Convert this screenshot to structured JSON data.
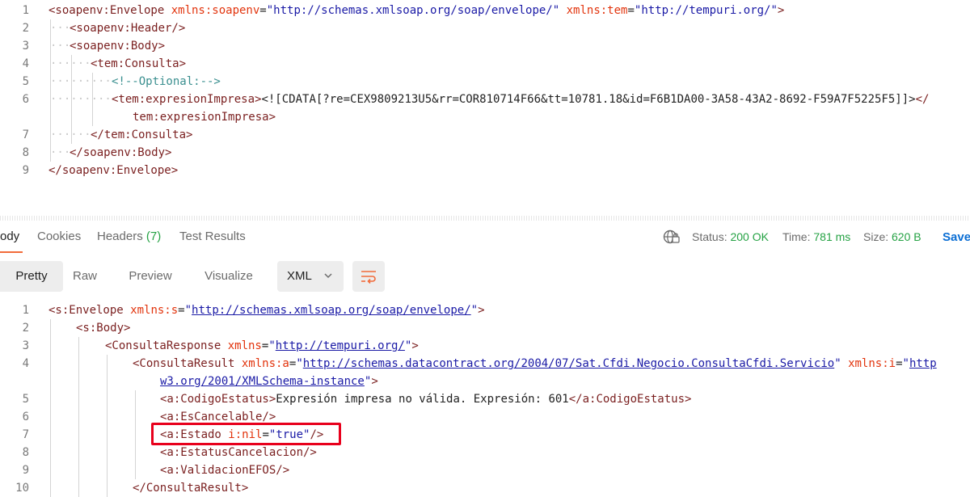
{
  "request": {
    "lines": [
      {
        "n": "1",
        "segs": [
          [
            "tag",
            "<soapenv:Envelope "
          ],
          [
            "attr",
            "xmlns:soapenv"
          ],
          [
            "dark",
            "="
          ],
          [
            "str",
            "\"http://schemas.xmlsoap.org/soap/envelope/\""
          ],
          [
            "dark",
            " "
          ],
          [
            "attr",
            "xmlns:tem"
          ],
          [
            "dark",
            "="
          ],
          [
            "str",
            "\"http://tempuri.org/\""
          ],
          [
            "tag",
            ">"
          ]
        ]
      },
      {
        "n": "2",
        "segs": [
          [
            "tag",
            "<soapenv:Header/>"
          ]
        ]
      },
      {
        "n": "3",
        "segs": [
          [
            "tag",
            "<soapenv:Body>"
          ]
        ]
      },
      {
        "n": "4",
        "segs": [
          [
            "tag",
            "<tem:Consulta>"
          ]
        ]
      },
      {
        "n": "5",
        "segs": [
          [
            "com",
            "<!--Optional:-->"
          ]
        ]
      },
      {
        "n": "6",
        "segs": [
          [
            "tag",
            "<tem:expresionImpresa>"
          ],
          [
            "dark",
            "<![CDATA[?re=CEX9809213U5&rr=COR810714F66&tt=10781.18&id=F6B1DA00-3A58-43A2-8692-F59A7F5225F5]]>"
          ],
          [
            "tag",
            "</"
          ]
        ]
      },
      {
        "n": "",
        "segs": [
          [
            "tag",
            "tem:expresionImpresa>"
          ]
        ]
      },
      {
        "n": "7",
        "segs": [
          [
            "tag",
            "</tem:Consulta>"
          ]
        ]
      },
      {
        "n": "8",
        "segs": [
          [
            "tag",
            "</soapenv:Body>"
          ]
        ]
      },
      {
        "n": "9",
        "segs": [
          [
            "tag",
            "</soapenv:Envelope>"
          ]
        ]
      }
    ]
  },
  "response_tabs": [
    {
      "label": "ody",
      "active": true
    },
    {
      "label": "Cookies",
      "active": false
    },
    {
      "label": "Headers",
      "count": "(7)",
      "active": false
    },
    {
      "label": "Test Results",
      "active": false
    }
  ],
  "status": {
    "status_label": "Status:",
    "status_value": "200 OK",
    "time_label": "Time:",
    "time_value": "781 ms",
    "size_label": "Size:",
    "size_value": "620 B",
    "save_label": "Save"
  },
  "formats": [
    "Pretty",
    "Raw",
    "Preview",
    "Visualize"
  ],
  "language": "XML",
  "response": {
    "lines": [
      {
        "n": "1",
        "segs": [
          [
            "tag",
            "<s:Envelope "
          ],
          [
            "attr",
            "xmlns:s"
          ],
          [
            "dark",
            "="
          ],
          [
            "str",
            "\""
          ],
          [
            "link",
            "http://schemas.xmlsoap.org/soap/envelope/"
          ],
          [
            "str",
            "\""
          ],
          [
            "tag",
            ">"
          ]
        ]
      },
      {
        "n": "2",
        "segs": [
          [
            "tag",
            "<s:Body>"
          ]
        ]
      },
      {
        "n": "3",
        "segs": [
          [
            "tag",
            "<ConsultaResponse "
          ],
          [
            "attr",
            "xmlns"
          ],
          [
            "dark",
            "="
          ],
          [
            "str",
            "\""
          ],
          [
            "link",
            "http://tempuri.org/"
          ],
          [
            "str",
            "\""
          ],
          [
            "tag",
            ">"
          ]
        ]
      },
      {
        "n": "4",
        "segs": [
          [
            "tag",
            "<ConsultaResult "
          ],
          [
            "attr",
            "xmlns:a"
          ],
          [
            "dark",
            "="
          ],
          [
            "str",
            "\""
          ],
          [
            "link",
            "http://schemas.datacontract.org/2004/07/Sat.Cfdi.Negocio.ConsultaCfdi.Servicio"
          ],
          [
            "str",
            "\""
          ],
          [
            "dark",
            " "
          ],
          [
            "attr",
            "xmlns:i"
          ],
          [
            "dark",
            "="
          ],
          [
            "str",
            "\""
          ],
          [
            "link",
            "http"
          ]
        ]
      },
      {
        "n": "",
        "segs": [
          [
            "link",
            "w3.org/2001/XMLSchema-instance"
          ],
          [
            "str",
            "\""
          ],
          [
            "tag",
            ">"
          ]
        ]
      },
      {
        "n": "5",
        "segs": [
          [
            "tag",
            "<a:CodigoEstatus>"
          ],
          [
            "dark",
            "Expresión impresa no válida. Expresión: 601"
          ],
          [
            "tag",
            "</a:CodigoEstatus>"
          ]
        ]
      },
      {
        "n": "6",
        "segs": [
          [
            "tag",
            "<a:EsCancelable/>"
          ]
        ]
      },
      {
        "n": "7",
        "segs": [
          [
            "tag",
            "<a:Estado "
          ],
          [
            "attr",
            "i:nil"
          ],
          [
            "dark",
            "="
          ],
          [
            "str",
            "\"true\""
          ],
          [
            "tag",
            "/>"
          ]
        ]
      },
      {
        "n": "8",
        "segs": [
          [
            "tag",
            "<a:EstatusCancelacion/>"
          ]
        ]
      },
      {
        "n": "9",
        "segs": [
          [
            "tag",
            "<a:ValidacionEFOS/>"
          ]
        ]
      },
      {
        "n": "10",
        "segs": [
          [
            "tag",
            "</ConsultaResult>"
          ]
        ]
      }
    ]
  }
}
